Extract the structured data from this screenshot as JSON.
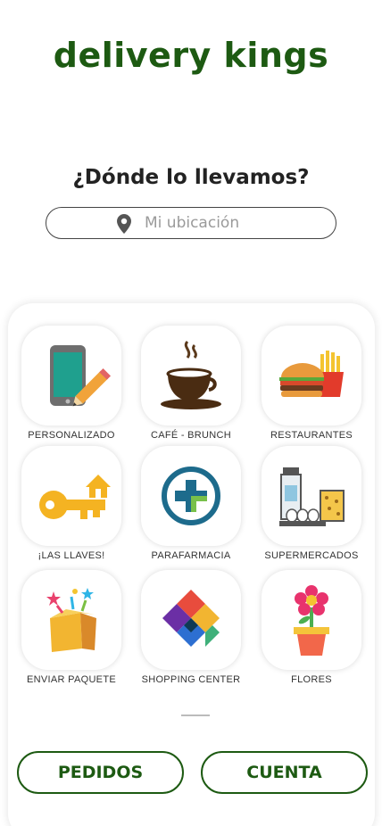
{
  "brand": {
    "name": "delivery kings",
    "color": "#1d5a12"
  },
  "header": {
    "question": "¿Dónde lo llevamos?"
  },
  "location": {
    "placeholder": "Mi ubicación",
    "icon": "location-pin-icon"
  },
  "categories": [
    {
      "label": "PERSONALIZADO",
      "icon": "phone-pencil-icon"
    },
    {
      "label": "CAFÉ - BRUNCH",
      "icon": "coffee-cup-icon"
    },
    {
      "label": "RESTAURANTES",
      "icon": "burger-fries-icon"
    },
    {
      "label": "¡LAS LLAVES!",
      "icon": "house-key-icon"
    },
    {
      "label": "PARAFARMACIA",
      "icon": "pharmacy-cross-icon"
    },
    {
      "label": "SUPERMERCADOS",
      "icon": "groceries-icon"
    },
    {
      "label": "ENVIAR PAQUETE",
      "icon": "gift-box-icon"
    },
    {
      "label": "SHOPPING CENTER",
      "icon": "shopping-diamonds-icon"
    },
    {
      "label": "FLORES",
      "icon": "flower-pot-icon"
    }
  ],
  "footer": {
    "orders_label": "PEDIDOS",
    "account_label": "CUENTA"
  }
}
